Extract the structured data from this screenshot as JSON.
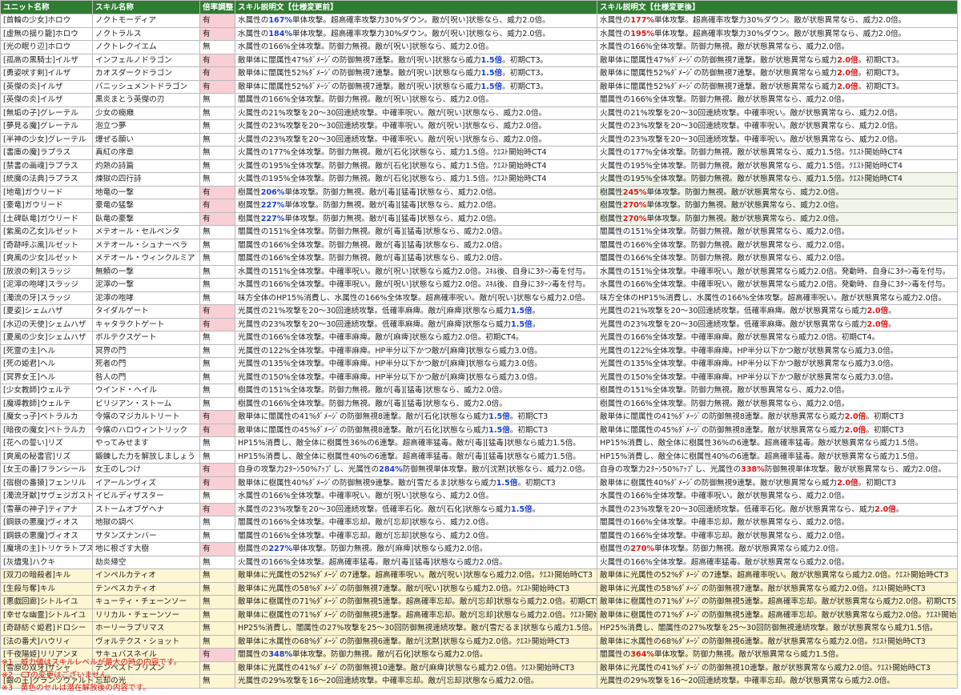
{
  "headers": {
    "unit": "ユニット名称",
    "skill": "スキル名称",
    "adjust": "倍率調整",
    "before": "スキル説明文【仕様変更前】",
    "after": "スキル説明文【仕様変更後】"
  },
  "rows": [
    {
      "unit": "[首輪の少女]ホロウ",
      "skill": "ノクトモーディア",
      "adj": "有",
      "before": [
        {
          "t": "水属性の"
        },
        {
          "t": "167%",
          "c": "b"
        },
        {
          "t": "単体攻撃。超高確率攻撃力30%ダウン。敵が[呪い]状態なら、威力2.0倍。"
        }
      ],
      "after": [
        {
          "t": "水属性の"
        },
        {
          "t": "177%",
          "c": "r"
        },
        {
          "t": "単体攻撃。超高確率攻撃力30%ダウン。敵が状態異常なら、威力2.0倍。"
        }
      ]
    },
    {
      "unit": "[虚無の揺り籠]ホロウ",
      "skill": "ノクトラルス",
      "adj": "有",
      "before": [
        {
          "t": "水属性の"
        },
        {
          "t": "184%",
          "c": "b"
        },
        {
          "t": "単体攻撃。超高確率攻撃力30%ダウン。敵が[呪い]状態なら、威力2.0倍。"
        }
      ],
      "after": [
        {
          "t": "水属性の"
        },
        {
          "t": "195%",
          "c": "r"
        },
        {
          "t": "単体攻撃。超高確率攻撃力30%ダウン。敵が状態異常なら、威力2.0倍。"
        }
      ]
    },
    {
      "unit": "[光の眠り辺]ホロウ",
      "skill": "ノクトレクイエム",
      "adj": "無",
      "before": [
        {
          "t": "水属性の166%全体攻撃。防御力無視。敵が[呪い]状態なら、威力2.0倍。"
        }
      ],
      "after": [
        {
          "t": "水属性の166%全体攻撃。防御力無視。敵が状態異常なら、威力2.0倍。"
        }
      ]
    },
    {
      "unit": "[孤高の黒騎士]イルザ",
      "skill": "インフェルノドラゴン",
      "adj": "有",
      "before": [
        {
          "t": "敵単体に闇属性47%ﾀﾞﾒｰｼﾞの防御無視7連撃。敵が[呪い]状態なら威力"
        },
        {
          "t": "1.5倍",
          "c": "b"
        },
        {
          "t": "。初期CT3。"
        }
      ],
      "after": [
        {
          "t": "敵単体に闇属性47%ﾀﾞﾒｰｼﾞの防御無視7連撃。敵が状態異常なら威力"
        },
        {
          "t": "2.0倍",
          "c": "r"
        },
        {
          "t": "。初期CT3。"
        }
      ]
    },
    {
      "unit": "[勇姿吠す剣]イルザ",
      "skill": "カオスダークドラゴン",
      "adj": "有",
      "before": [
        {
          "t": "敵単体に闇属性52%ﾀﾞﾒｰｼﾞの防御無視7連撃。敵が[呪い]状態なら威力"
        },
        {
          "t": "1.5倍",
          "c": "b"
        },
        {
          "t": "。初期CT3。"
        }
      ],
      "after": [
        {
          "t": "敵単体に闇属性52%ﾀﾞﾒｰｼﾞの防御無視7連撃。敵が状態異常なら威力"
        },
        {
          "t": "2.0倍",
          "c": "r"
        },
        {
          "t": "。初期CT3。"
        }
      ]
    },
    {
      "unit": "[英傑の炎]イルザ",
      "skill": "バニッシュメントドラゴン",
      "adj": "有",
      "before": [
        {
          "t": "敵単体に闇属性52%ﾀﾞﾒｰｼﾞの防御無視7連撃。敵が[呪い]状態なら威力"
        },
        {
          "t": "1.5倍",
          "c": "b"
        },
        {
          "t": "。初期CT3。"
        }
      ],
      "after": [
        {
          "t": "敵単体に闇属性52%ﾀﾞﾒｰｼﾞの防御無視7連撃。敵が状態異常なら威力"
        },
        {
          "t": "2.0倍",
          "c": "r"
        },
        {
          "t": "。初期CT3。"
        }
      ]
    },
    {
      "unit": "[英傑の炎]イルザ",
      "skill": "黒炎まとう英傑の刃",
      "adj": "無",
      "before": [
        {
          "t": "闇属性の166%全体攻撃。防御力無視。敵が[呪い]状態なら、威力2.0倍。"
        }
      ],
      "after": [
        {
          "t": "闇属性の166%全体攻撃。防御力無視。敵が状態異常なら、威力2.0倍。"
        }
      ]
    },
    {
      "unit": "[無垢の子]グレーテル",
      "skill": "少女の癇癪",
      "adj": "無",
      "before": [
        {
          "t": "火属性の21%攻撃を20～30回連続攻撃。中確率呪い。敵が[呪い]状態なら、威力2.0倍。"
        }
      ],
      "after": [
        {
          "t": "火属性の21%攻撃を20～30回連続攻撃。中確率呪い。敵が状態異常なら、威力2.0倍。"
        }
      ]
    },
    {
      "unit": "[夢見る魔]グレーテル",
      "skill": "泡立つ夢",
      "adj": "無",
      "before": [
        {
          "t": "火属性の23%攻撃を20～30回連続攻撃。中確率呪い。敵が[呪い]状態なら、威力2.0倍。"
        }
      ],
      "after": [
        {
          "t": "火属性の23%攻撃を20～30回連続攻撃。中確率呪い。敵が状態異常なら、威力2.0倍。"
        }
      ]
    },
    {
      "unit": "[半神の少女]グレーテル",
      "skill": "爆ぜる願い",
      "adj": "無",
      "before": [
        {
          "t": "火属性の23%攻撃を20～30回連続攻撃。中確率呪い。敵が[呪い]状態なら、威力2.0倍。"
        }
      ],
      "after": [
        {
          "t": "火属性の23%攻撃を20～30回連続攻撃。中確率呪い。敵が状態異常なら、威力2.0倍。"
        }
      ]
    },
    {
      "unit": "[書庫の魔]ラプラス",
      "skill": "真紅の序章",
      "adj": "無",
      "before": [
        {
          "t": "火属性の177%全体攻撃。防御力無視。敵が[石化]状態なら、威力1.5倍。ｸｴｽﾄ開始時CT4"
        }
      ],
      "after": [
        {
          "t": "火属性の177%全体攻撃。防御力無視。敵が状態異常なら、威力1.5倍。ｸｴｽﾄ開始時CT4"
        }
      ]
    },
    {
      "unit": "[禁書の画魂]ラプラス",
      "skill": "灼熱の詩篇",
      "adj": "無",
      "before": [
        {
          "t": "火属性の195%全体攻撃。防御力無視。敵が[石化]状態なら、威力1.5倍。ｸｴｽﾄ開始時CT4"
        }
      ],
      "after": [
        {
          "t": "火属性の195%全体攻撃。防御力無視。敵が状態異常なら、威力1.5倍。ｸｴｽﾄ開始時CT4"
        }
      ]
    },
    {
      "unit": "[統魔の法典]ラプラス",
      "skill": "煉獄の四行詩",
      "adj": "無",
      "before": [
        {
          "t": "火属性の195%全体攻撃。防御力無視。敵が[石化]状態なら、威力1.5倍。ｸｴｽﾄ開始時CT4"
        }
      ],
      "after": [
        {
          "t": "火属性の195%全体攻撃。防御力無視。敵が状態異常なら、威力1.5倍。ｸｴｽﾄ開始時CT4"
        }
      ]
    },
    {
      "unit": "[地竜]ガウリード",
      "skill": "地竜の一撃",
      "adj": "有",
      "before": [
        {
          "t": "樹属性"
        },
        {
          "t": "206%",
          "c": "b"
        },
        {
          "t": "単体攻撃。防御力無視。敵が[毒][猛毒]状態なら、威力2.0倍。"
        }
      ],
      "after": [
        {
          "t": "樹属性"
        },
        {
          "t": "245%",
          "c": "r"
        },
        {
          "t": "単体攻撃。防御力無視。敵が状態異常なら、威力2.0倍。"
        }
      ]
    },
    {
      "unit": "[豪竜]ガウリード",
      "skill": "豪竜の猛撃",
      "adj": "有",
      "before": [
        {
          "t": "樹属性"
        },
        {
          "t": "227%",
          "c": "b"
        },
        {
          "t": "単体攻撃。防御力無視。敵が[毒][猛毒]状態なら、威力2.0倍。"
        }
      ],
      "after": [
        {
          "t": "樹属性"
        },
        {
          "t": "270%",
          "c": "r"
        },
        {
          "t": "単体攻撃。防御力無視。敵が状態異常なら、威力2.0倍。"
        }
      ]
    },
    {
      "unit": "[土碑臥竜]ガウリード",
      "skill": "臥竜の豪撃",
      "adj": "有",
      "before": [
        {
          "t": "樹属性"
        },
        {
          "t": "227%",
          "c": "b"
        },
        {
          "t": "単体攻撃。防御力無視。敵が[毒][猛毒]状態なら、威力2.0倍。"
        }
      ],
      "after": [
        {
          "t": "樹属性"
        },
        {
          "t": "270%",
          "c": "r"
        },
        {
          "t": "単体攻撃。防御力無視。敵が状態異常なら、威力2.0倍。"
        }
      ]
    },
    {
      "unit": "[紫風の乙女]ルゼット",
      "skill": "メテオール・セルペンタ",
      "adj": "無",
      "before": [
        {
          "t": "闇属性の151%全体攻撃。防御力無視。敵が[毒][猛毒]状態なら、威力2.0倍。"
        }
      ],
      "after": [
        {
          "t": "闇属性の151%全体攻撃。防御力無視。敵が状態異常なら、威力2.0倍。"
        }
      ]
    },
    {
      "unit": "[奇跡呼ぶ風]ルゼット",
      "skill": "メテオール・シュナーベラ",
      "adj": "無",
      "before": [
        {
          "t": "闇属性の166%全体攻撃。防御力無視。敵が[毒][猛毒]状態なら、威力2.0倍。"
        }
      ],
      "after": [
        {
          "t": "闇属性の166%全体攻撃。防御力無視。敵が状態異常なら、威力2.0倍。"
        }
      ]
    },
    {
      "unit": "[爽風の少女]ルゼット",
      "skill": "メテオール・ウィンクルミア",
      "adj": "無",
      "before": [
        {
          "t": "闇属性の166%全体攻撃。防御力無視。敵が[毒][猛毒]状態なら、威力2.0倍。"
        }
      ],
      "after": [
        {
          "t": "闇属性の166%全体攻撃。防御力無視。敵が状態異常なら、威力2.0倍。"
        }
      ]
    },
    {
      "unit": "[放浪の剣]スラッジ",
      "skill": "無頼の一撃",
      "adj": "無",
      "before": [
        {
          "t": "水属性の151%全体攻撃。中確率呪い。敵が[呪い]状態なら威力2.0倍。ｽｷﾙ後、自身に3ﾀｰﾝ毒を付与。"
        }
      ],
      "after": [
        {
          "t": "水属性の151%全体攻撃。中確率呪い。敵が状態異常なら威力2.0倍。発動時、自身に3ﾀｰﾝ毒を付与。"
        }
      ]
    },
    {
      "unit": "[泥濘の咆哮]スラッジ",
      "skill": "泥濘の一撃",
      "adj": "無",
      "before": [
        {
          "t": "水属性の166%全体攻撃。中確率呪い。敵が[呪い]状態なら威力2.0倍。ｽｷﾙ後、自身に3ﾀｰﾝ毒を付与。"
        }
      ],
      "after": [
        {
          "t": "水属性の166%全体攻撃。中確率呪い。敵が状態異常なら威力2.0倍。発動時、自身に3ﾀｰﾝ毒を付与。"
        }
      ]
    },
    {
      "unit": "[濁流の牙]スラッジ",
      "skill": "泥濘の咆哮",
      "adj": "無",
      "before": [
        {
          "t": "味方全体のHP15%消費し、水属性の166%全体攻撃。超高確率呪い。敵が[呪い]状態なら威力2.0倍。"
        }
      ],
      "after": [
        {
          "t": "味方全体のHP15%消費し、水属性の166%全体攻撃。超高確率呪い。敵が状態異常なら威力2.0倍。"
        }
      ]
    },
    {
      "unit": "[夏姿]シェムハザ",
      "skill": "タイダルゲート",
      "adj": "有",
      "before": [
        {
          "t": "光属性の21%攻撃を20～30回連続攻撃。低確率麻痺。敵が[麻痺]状態なら威力"
        },
        {
          "t": "1.5倍",
          "c": "b"
        },
        {
          "t": "。"
        }
      ],
      "after": [
        {
          "t": "光属性の21%攻撃を20～30回連続攻撃。低確率麻痺。敵が状態異常なら威力"
        },
        {
          "t": "2.0倍",
          "c": "r"
        },
        {
          "t": "。"
        }
      ]
    },
    {
      "unit": "[水辺の天使]シェムハザ",
      "skill": "キャタラクトゲート",
      "adj": "有",
      "before": [
        {
          "t": "光属性の23%攻撃を20～30回連続攻撃。低確率麻痺。敵が[麻痺]状態なら威力"
        },
        {
          "t": "1.5倍",
          "c": "b"
        },
        {
          "t": "。"
        }
      ],
      "after": [
        {
          "t": "光属性の23%攻撃を20～30回連続攻撃。低確率麻痺。敵が状態異常なら威力"
        },
        {
          "t": "2.0倍",
          "c": "r"
        },
        {
          "t": "。"
        }
      ]
    },
    {
      "unit": "[夏風の少女]シェムハザ",
      "skill": "ボルテクスゲート",
      "adj": "無",
      "before": [
        {
          "t": "光属性の166%全体攻撃。中確率麻痺。敵が[麻痺]状態なら威力2.0倍。初期CT4。"
        }
      ],
      "after": [
        {
          "t": "光属性の166%全体攻撃。中確率麻痺。敵が状態異常なら威力2.0倍。初期CT4。"
        }
      ]
    },
    {
      "unit": "[死霊の主]ヘル",
      "skill": "冥界の門",
      "adj": "無",
      "before": [
        {
          "t": "光属性の122%全体攻撃。中確率麻痺。HP半分以下かつ敵が[麻痺]状態なら威力3.0倍。"
        }
      ],
      "after": [
        {
          "t": "光属性の122%全体攻撃。中確率麻痺。HP半分以下かつ敵が状態異常なら威力3.0倍。"
        }
      ]
    },
    {
      "unit": "[死の姫君]ヘル",
      "skill": "死者の門",
      "adj": "無",
      "before": [
        {
          "t": "光属性の135%全体攻撃。中確率麻痺。HP半分以下かつ敵が[麻痺]状態なら威力3.0倍。"
        }
      ],
      "after": [
        {
          "t": "光属性の135%全体攻撃。中確率麻痺。HP半分以下かつ敵が状態異常なら威力3.0倍。"
        }
      ]
    },
    {
      "unit": "[冥界女王]ヘル",
      "skill": "咎人の門",
      "adj": "無",
      "before": [
        {
          "t": "光属性の150%全体攻撃。中確率麻痺。HP半分以下かつ敵が[麻痺]状態なら威力3.0倍。"
        }
      ],
      "after": [
        {
          "t": "光属性の150%全体攻撃。中確率麻痺。HP半分以下かつ敵が状態異常なら威力3.0倍。"
        }
      ]
    },
    {
      "unit": "[少女教師]ウェルテ",
      "skill": "ウインド・ヘイル",
      "adj": "無",
      "before": [
        {
          "t": "樹属性の151%全体攻撃。防御力無視。敵が[毒][猛毒]状態なら、威力2.0倍。"
        }
      ],
      "after": [
        {
          "t": "樹属性の151%全体攻撃。防御力無視。敵が状態異常なら、威力2.0倍。"
        }
      ]
    },
    {
      "unit": "[魔導教師]ウェルテ",
      "skill": "ビリジアン・ストーム",
      "adj": "無",
      "before": [
        {
          "t": "樹属性の166%全体攻撃。防御力無視。敵が[毒][猛毒]状態なら、威力2.0倍。"
        }
      ],
      "after": [
        {
          "t": "樹属性の166%全体攻撃。防御力無視。敵が状態異常なら、威力2.0倍。"
        }
      ]
    },
    {
      "unit": "[魔女っ子]ペトラルカ",
      "skill": "令嬢のマジカルトリート",
      "adj": "有",
      "before": [
        {
          "t": "敵単体に闇属性の41%ﾀﾞﾒｰｼﾞの防御無視8連撃。敵が[石化]状態なら威力"
        },
        {
          "t": "1.5倍",
          "c": "b"
        },
        {
          "t": "。初期CT3"
        }
      ],
      "after": [
        {
          "t": "敵単体に闇属性の41%ﾀﾞﾒｰｼﾞの防御無視8連撃。敵が状態異常なら威力"
        },
        {
          "t": "2.0倍",
          "c": "r"
        },
        {
          "t": "。初期CT3"
        }
      ]
    },
    {
      "unit": "[暗夜の魔女]ペトラルカ",
      "skill": "令嬢のハロウィントリック",
      "adj": "有",
      "before": [
        {
          "t": "敵単体に闇属性の45%ﾀﾞﾒｰｼﾞの防御無視8連撃。敵が[石化]状態なら威力"
        },
        {
          "t": "1.5倍",
          "c": "b"
        },
        {
          "t": "。初期CT3"
        }
      ],
      "after": [
        {
          "t": "敵単体に闇属性の45%ﾀﾞﾒｰｼﾞの防御無視8連撃。敵が状態異常なら威力"
        },
        {
          "t": "2.0倍",
          "c": "r"
        },
        {
          "t": "。初期CT3"
        }
      ]
    },
    {
      "unit": "[花への誓い]リズ",
      "skill": "やってみせます",
      "adj": "無",
      "before": [
        {
          "t": "HP15%消費し、敵全体に樹属性36%の6連撃。超高確率猛毒。敵が[毒][猛毒]状態なら威力1.5倍。"
        }
      ],
      "after": [
        {
          "t": "HP15%消費し、敵全体に樹属性36%の6連撃。超高確率猛毒。敵が状態異常なら威力1.5倍。"
        }
      ]
    },
    {
      "unit": "[爽風の秘書官]リズ",
      "skill": "鍛錬した力を解放しましょう",
      "adj": "無",
      "before": [
        {
          "t": "HP15%消費し、敵全体に樹属性40%の6連撃。超高確率猛毒。敵が[毒][猛毒]状態なら威力1.5倍。"
        }
      ],
      "after": [
        {
          "t": "HP15%消費し、敵全体に樹属性40%の6連撃。超高確率猛毒。敵が状態異常なら威力1.5倍。"
        }
      ]
    },
    {
      "unit": "[女王の番]フランシール",
      "skill": "女王のしつけ",
      "adj": "有",
      "before": [
        {
          "t": "自身の攻撃力2ﾀｰﾝ50%ｱｯﾌﾟし、光属性の"
        },
        {
          "t": "284%",
          "c": "b"
        },
        {
          "t": "防御無視単体攻撃。敵が[沈黙]状態なら、威力2.0倍。"
        }
      ],
      "after": [
        {
          "t": "自身の攻撃力2ﾀｰﾝ50%ｱｯﾌﾟし、光属性の"
        },
        {
          "t": "338%",
          "c": "r"
        },
        {
          "t": "防御無視単体攻撃。敵が状態異常なら、威力2.0倍。"
        }
      ]
    },
    {
      "unit": "[宿樹の番猿]フェンリル",
      "skill": "イアールンヴィズ",
      "adj": "有",
      "before": [
        {
          "t": "敵単体に樹属性40%ﾀﾞﾒｰｼﾞの防御無視9連撃。敵が[雪だるま]状態なら威力"
        },
        {
          "t": "1.5倍",
          "c": "b"
        },
        {
          "t": "。初期CT3"
        }
      ],
      "after": [
        {
          "t": "敵単体に樹属性40%ﾀﾞﾒｰｼﾞの防御無視9連撃。敵が状態異常なら威力"
        },
        {
          "t": "2.0倍",
          "c": "r"
        },
        {
          "t": "。初期CT3"
        }
      ]
    },
    {
      "unit": "[濁流牙獣]サヴェジガスト",
      "skill": "イビルディザスター",
      "adj": "無",
      "before": [
        {
          "t": "水属性の166%全体攻撃。中確率呪い。敵が[呪い]状態なら、威力2.0倍。"
        }
      ],
      "after": [
        {
          "t": "水属性の166%全体攻撃。中確率呪い。敵が状態異常なら、威力2.0倍。"
        }
      ]
    },
    {
      "unit": "[雪華の神子]ティアナ",
      "skill": "ストームオブゲヘナ",
      "adj": "有",
      "before": [
        {
          "t": "水属性の23%攻撃を20～30回連続攻撃。低確率石化。敵が[石化]状態なら威力"
        },
        {
          "t": "1.5倍",
          "c": "b"
        },
        {
          "t": "。"
        }
      ],
      "after": [
        {
          "t": "水属性の23%攻撃を20～30回連続攻撃。低確率石化。敵が状態異常なら、威力"
        },
        {
          "t": "2.0倍",
          "c": "r"
        },
        {
          "t": "。"
        }
      ]
    },
    {
      "unit": "[鋼鉄の悪魔]ヴィオス",
      "skill": "地獄の調べ",
      "adj": "無",
      "before": [
        {
          "t": "闇属性の166%全体攻撃。中確率忘却。敵が[忘却]状態なら、威力2.0倍。"
        }
      ],
      "after": [
        {
          "t": "闇属性の166%全体攻撃。中確率忘却。敵が状態異常なら、威力2.0倍。"
        }
      ]
    },
    {
      "unit": "[鋼鉄の悪魔]ヴィオス",
      "skill": "サタンズナンバー",
      "adj": "無",
      "before": [
        {
          "t": "闇属性の166%全体攻撃。中確率忘却。敵が[忘却]状態なら、威力2.0倍。"
        }
      ],
      "after": [
        {
          "t": "闇属性の166%全体攻撃。中確率忘却。敵が状態異常なら、威力2.0倍。"
        }
      ]
    },
    {
      "unit": "[魔境の主]トリケラトプス",
      "skill": "地に根ざす大樹",
      "adj": "有",
      "before": [
        {
          "t": "樹属性の"
        },
        {
          "t": "227%",
          "c": "b"
        },
        {
          "t": "単体攻撃。防御力無視。敵が[麻痺]状態なら威力2.0倍。"
        }
      ],
      "after": [
        {
          "t": "樹属性の"
        },
        {
          "t": "270%",
          "c": "r"
        },
        {
          "t": "単体攻撃。防御力無視。敵が状態異常なら威力2.0倍。"
        }
      ]
    },
    {
      "unit": "[灰燼鬼]ハクキ",
      "skill": "劫炎帰空",
      "adj": "無",
      "before": [
        {
          "t": "火属性の166%全体攻撃。超高確率猛毒。敵が[毒][猛毒]状態なら威力2.0倍。"
        }
      ],
      "after": [
        {
          "t": "火属性の166%全体攻撃。超高確率猛毒。敵が状態異常なら威力2.0倍。"
        }
      ]
    },
    {
      "unit": "[双刀の暗殺者]キル",
      "skill": "インペルカティオ",
      "adj": "無",
      "latent": true,
      "before": [
        {
          "t": "敵単体に光属性の52%ﾀﾞﾒｰｼﾞの7連撃。超高確率呪い。敵が[呪い]状態なら威力2.0倍。ｸｴｽﾄ開始時CT3"
        }
      ],
      "after": [
        {
          "t": "敵単体に光属性の52%ﾀﾞﾒｰｼﾞの7連撃。超高確率呪い。敵が状態異常なら威力2.0倍。ｸｴｽﾄ開始時CT3"
        }
      ]
    },
    {
      "unit": "[生殺与奪]キル",
      "skill": "テンペスカティオ",
      "adj": "無",
      "latent": true,
      "before": [
        {
          "t": "敵単体に光属性の58%ﾀﾞﾒｰｼﾞの防御無視7連撃。敵が[呪い]状態なら威力2.0倍。ｸｴｽﾄ開始時CT3"
        }
      ],
      "after": [
        {
          "t": "敵単体に光属性の58%ﾀﾞﾒｰｼﾞの防御無視7連撃。敵が状態異常なら威力2.0倍。ｸｴｽﾄ開始時CT3"
        }
      ]
    },
    {
      "unit": "[悪戯回廊]シトルイユ",
      "skill": "キューティ・チェーンソー",
      "adj": "無",
      "latent": true,
      "before": [
        {
          "t": "敵単体に樹属性の71%ﾀﾞﾒｰｼﾞの防御無視5連撃。超高確率忘却。敵が[忘却]状態なら威力2.0倍。初期CT5"
        }
      ],
      "after": [
        {
          "t": "敵単体に樹属性の71%ﾀﾞﾒｰｼﾞの防御無視5連撃。超高確率忘却。敵が状態異常なら威力2.0倍。初期CT5"
        }
      ]
    },
    {
      "unit": "[幸せな幽霊]シトルイユ",
      "skill": "リリカル・チェーンソー",
      "adj": "無",
      "latent": true,
      "before": [
        {
          "t": "敵単体に樹属性の71%ﾀﾞﾒｰｼﾞの防御無視5連撃。超高確率忘却。敵が[忘却]状態なら威力2.0倍。ｸｴｽﾄ開始時CT3"
        }
      ],
      "after": [
        {
          "t": "敵単体に樹属性の71%ﾀﾞﾒｰｼﾞの防御無視5連撃。超高確率忘却。敵が状態異常なら威力2.0倍。ｸｴｽﾄ開始時CT3"
        }
      ]
    },
    {
      "unit": "[奇跡紡ぐ姫君]ドロシー",
      "skill": "ホーリーラプリマス",
      "adj": "無",
      "latent": true,
      "before": [
        {
          "t": "HP25%消費し、闇属性の27%攻撃を25～30回防御無視連続攻撃。敵が[雪だるま]状態なら威力1.5倍。"
        }
      ],
      "after": [
        {
          "t": "HP25%消費し、闇属性の27%攻撃を25～30回防御無視連続攻撃。敵が状態異常なら威力1.5倍。"
        }
      ]
    },
    {
      "unit": "[法の番犬]ハウリィ",
      "skill": "ヴォルテクス・ショット",
      "adj": "無",
      "latent": true,
      "before": [
        {
          "t": "敵単体に水属性の68%ﾀﾞﾒｰｼﾞの防御無視6連撃。敵が[沈黙]状態なら威力2.0倍。ｸｴｽﾄ開始時CT3"
        }
      ],
      "after": [
        {
          "t": "敵単体に水属性の68%ﾀﾞﾒｰｼﾞの防御無視6連撃。敵が状態異常なら威力2.0倍。ｸｴｽﾄ開始時CT3"
        }
      ]
    },
    {
      "unit": "[千夜陽姫]リリアンヌ",
      "skill": "サキュバスネイル",
      "adj": "有",
      "latent": true,
      "before": [
        {
          "t": "闇属性の"
        },
        {
          "t": "348%",
          "c": "b"
        },
        {
          "t": "単体攻撃。防御力無視。敵が[石化]状態なら威力2.0倍。"
        }
      ],
      "after": [
        {
          "t": "闇属性の"
        },
        {
          "t": "364%",
          "c": "r"
        },
        {
          "t": "単体攻撃。防御力無視。敵が状態異常なら威力1.5倍。"
        }
      ]
    },
    {
      "unit": "[雪原の双牙]サシャ",
      "skill": "テンペストブリズン",
      "adj": "無",
      "latent": true,
      "before": [
        {
          "t": "敵単体に光属性の41%ﾀﾞﾒｰｼﾞの防御無視10連撃。敵が[麻痺]状態なら威力2.0倍。ｸｴｽﾄ開始時CT3"
        }
      ],
      "after": [
        {
          "t": "敵単体に光属性の41%ﾀﾞﾒｰｼﾞの防御無視10連撃。敵が状態異常なら威力2.0倍。ｸｴｽﾄ開始時CT3"
        }
      ]
    },
    {
      "unit": "[銀の王]グランツヴァルト",
      "skill": "忘却の光",
      "adj": "無",
      "latent": true,
      "before": [
        {
          "t": "光属性の29%攻撃を16～20回連続攻撃。中確率忘却。敵が[忘却]状態なら威力2.0倍。"
        }
      ],
      "after": [
        {
          "t": "光属性の29%攻撃を16～20回連続攻撃。中確率忘却。敵が状態異常なら威力2.0倍。"
        }
      ]
    }
  ],
  "notes": [
    "※1　威力値はスキルレベルが最大の時の内容です。",
    "※2　CTの変更はございません。",
    "※3　黄色のセルは潜在解放後の内容です。"
  ],
  "colors": {
    "header_bg": "#2e7d32",
    "adjust_yes": "#f9cfd6",
    "before_highlight": "#1a3fd6",
    "after_highlight": "#e11515",
    "latent_row": "#fdf6d2"
  }
}
